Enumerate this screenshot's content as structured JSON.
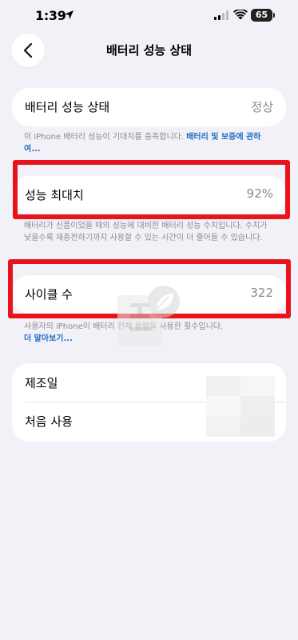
{
  "status_bar": {
    "time": "1:39",
    "battery": "65"
  },
  "nav": {
    "title": "배터리 성능 상태",
    "back_icon": "chevron-left-icon"
  },
  "battery_health": {
    "label": "배터리 성능 상태",
    "value": "정상",
    "note": "이 iPhone 배터리 성능이 기대치를 충족합니다. ",
    "note_link": "배터리 및 보증에 관하여..."
  },
  "max_capacity": {
    "label": "성능 최대치",
    "value": "92%",
    "note": "배터리가 신품이었을 때의 성능에 대비한 배터리 성능 수치입니다. 수치가 낮을수록 재충전하기까지 사용할 수 있는 시간이 더 줄어들 수 있습니다."
  },
  "cycle_count": {
    "label": "사이클 수",
    "value": "322",
    "note": "사용자의 iPhone이 배터리 전체 용량을 사용한 횟수입니다.",
    "note_link": "더 알아보기..."
  },
  "dates": {
    "manufactured_label": "제조일",
    "first_use_label": "처음 사용"
  },
  "colors": {
    "background": "#f2f1f7",
    "highlight": "#e8131b",
    "link": "#1f6fc5"
  }
}
